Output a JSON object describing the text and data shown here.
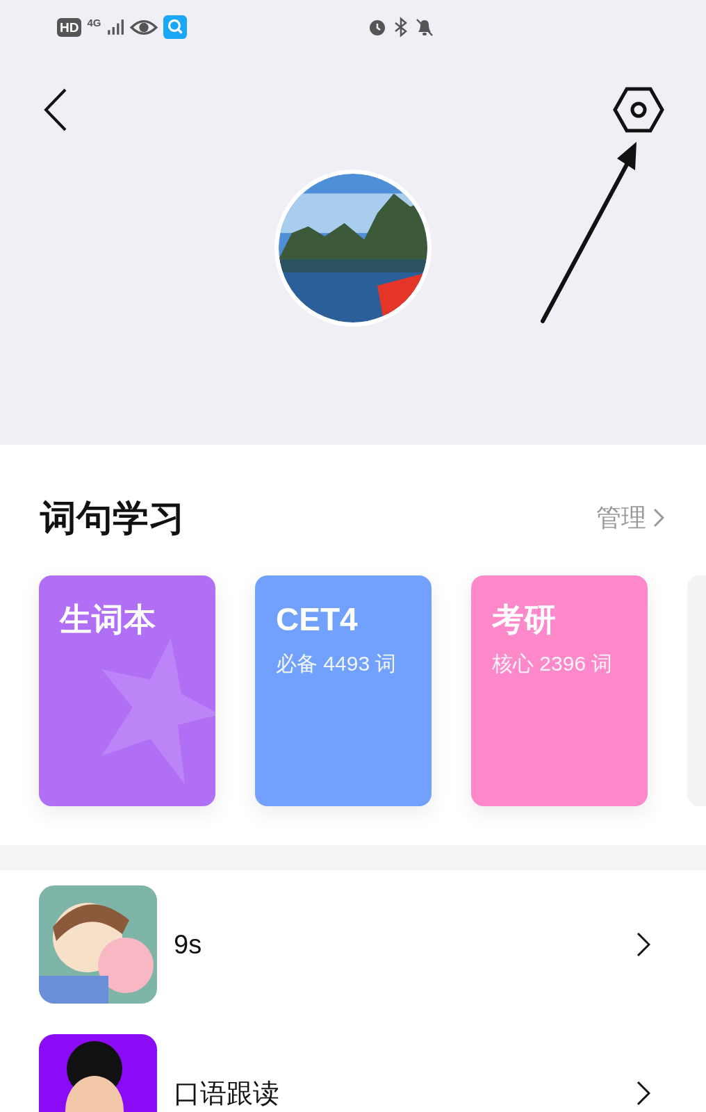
{
  "status_bar": {
    "hd_badge": "HD",
    "network": "4G"
  },
  "section": {
    "title": "词句学习",
    "action": "管理"
  },
  "cards": [
    {
      "kind": "wordbook",
      "title": "生词本",
      "color": "#b16ff6"
    },
    {
      "kind": "book",
      "title": "CET4",
      "subtitle": "必备 4493 词",
      "color": "#71a1fc"
    },
    {
      "kind": "book",
      "title": "考研",
      "subtitle": "核心 2396 词",
      "color": "#fd89ca"
    },
    {
      "kind": "partial",
      "color": "#f3f3f5"
    }
  ],
  "list": [
    {
      "title": "9s",
      "kind": "duo"
    },
    {
      "title": "口语跟读",
      "kind": "portrait"
    }
  ]
}
